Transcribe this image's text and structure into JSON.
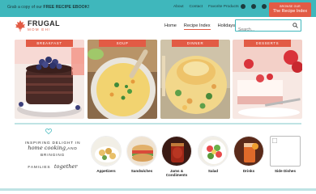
{
  "topbar": {
    "promo_prefix": "Grab a copy of our ",
    "promo_bold": "FREE RECIPE EBOOK!",
    "links": [
      "About",
      "Contact",
      "Favorite Products"
    ],
    "cta_small": "BROWSE OUR",
    "cta_label": "The Recipe Index",
    "accent": "#3fb7bc"
  },
  "header": {
    "logo_line1": "FRUGAL",
    "logo_line2": "MOM EH!",
    "nav": [
      "Home",
      "Recipe Index",
      "Holidays"
    ],
    "search_placeholder": "Search..."
  },
  "cards": [
    {
      "label": "BREAKFAST"
    },
    {
      "label": "SOUP"
    },
    {
      "label": "DINNER"
    },
    {
      "label": "DESSERTS"
    }
  ],
  "tagline": {
    "line1": "INSPIRING DELIGHT IN",
    "line2": "home cooking,",
    "line3": "AND BRINGING",
    "line4": "FAMILIES",
    "line5": "together"
  },
  "categories": [
    {
      "name": "Appetizers"
    },
    {
      "name": "Sandwiches"
    },
    {
      "name": "Jams & Condiments"
    },
    {
      "name": "Salad"
    },
    {
      "name": "Drinks"
    },
    {
      "name": "Side Dishes"
    }
  ],
  "colors": {
    "teal": "#3fb7bc",
    "coral": "#e25b45",
    "light_teal": "#bfe3e4"
  }
}
